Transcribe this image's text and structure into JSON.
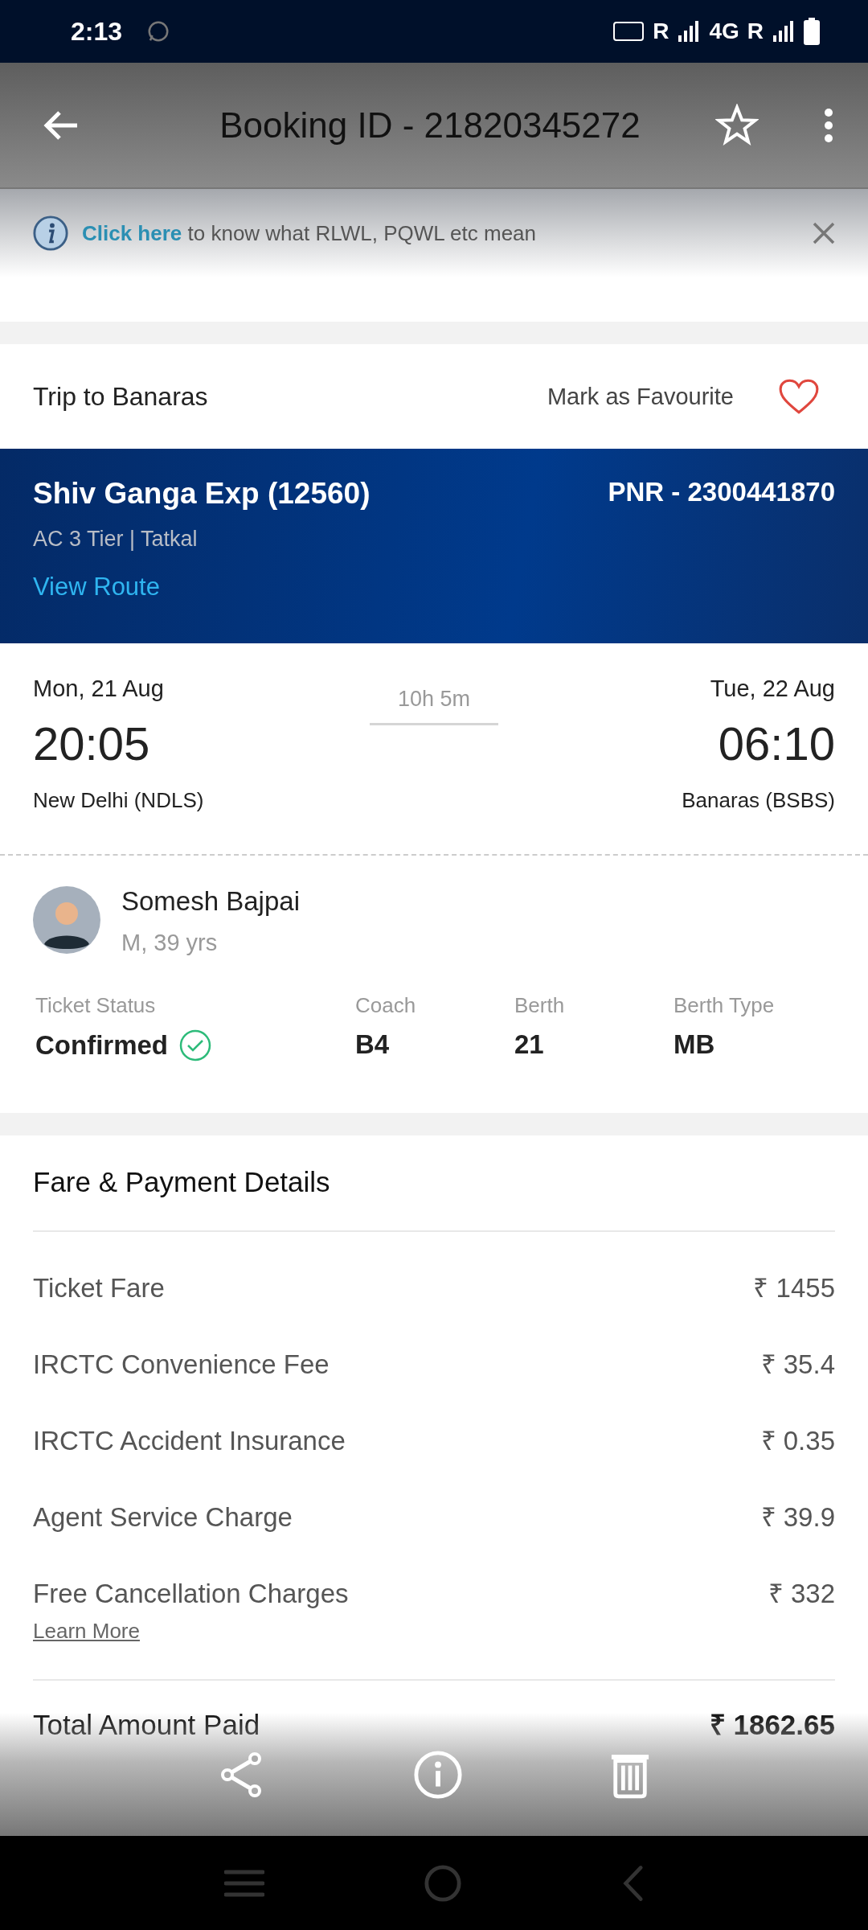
{
  "status_bar": {
    "time": "2:13",
    "network_labels": [
      "R",
      "4G",
      "R"
    ]
  },
  "header": {
    "title": "Booking ID - 21820345272",
    "starred": false
  },
  "info_banner": {
    "link": "Click here",
    "text": " to know what RLWL, PQWL etc mean"
  },
  "trip": {
    "title": "Trip to Banaras",
    "favourite_label": "Mark as Favourite",
    "favourite": false
  },
  "train": {
    "name": "Shiv Ganga Exp (12560)",
    "pnr": "PNR - 2300441870",
    "class_quota": "AC 3 Tier | Tatkal",
    "link": "View Route"
  },
  "journey": {
    "departure": {
      "date": "Mon, 21 Aug",
      "time": "20:05",
      "station": "New Delhi (NDLS)"
    },
    "duration": "10h 5m",
    "arrival": {
      "date": "Tue, 22 Aug",
      "time": "06:10",
      "station": "Banaras (BSBS)"
    }
  },
  "passenger": {
    "name": "Somesh Bajpai",
    "details": "M, 39 yrs",
    "confirmed": true,
    "fields": [
      {
        "label": "Ticket Status",
        "value": "Confirmed"
      },
      {
        "label": "Coach",
        "value": "B4"
      },
      {
        "label": "Berth",
        "value": "21"
      },
      {
        "label": "Berth Type",
        "value": "MB"
      }
    ]
  },
  "fare": {
    "title": "Fare & Payment Details",
    "rows": [
      {
        "label": "Ticket Fare",
        "amount": "₹ 1455"
      },
      {
        "label": "IRCTC Convenience Fee",
        "amount": "₹ 35.4"
      },
      {
        "label": "IRCTC Accident Insurance",
        "amount": "₹ 0.35"
      },
      {
        "label": "Agent Service Charge",
        "amount": "₹ 39.9"
      },
      {
        "label": "Free Cancellation Charges",
        "amount": "₹ 332",
        "link": "Learn More"
      }
    ],
    "total": {
      "label": "Total Amount Paid",
      "amount": "₹ 1862.65"
    }
  }
}
